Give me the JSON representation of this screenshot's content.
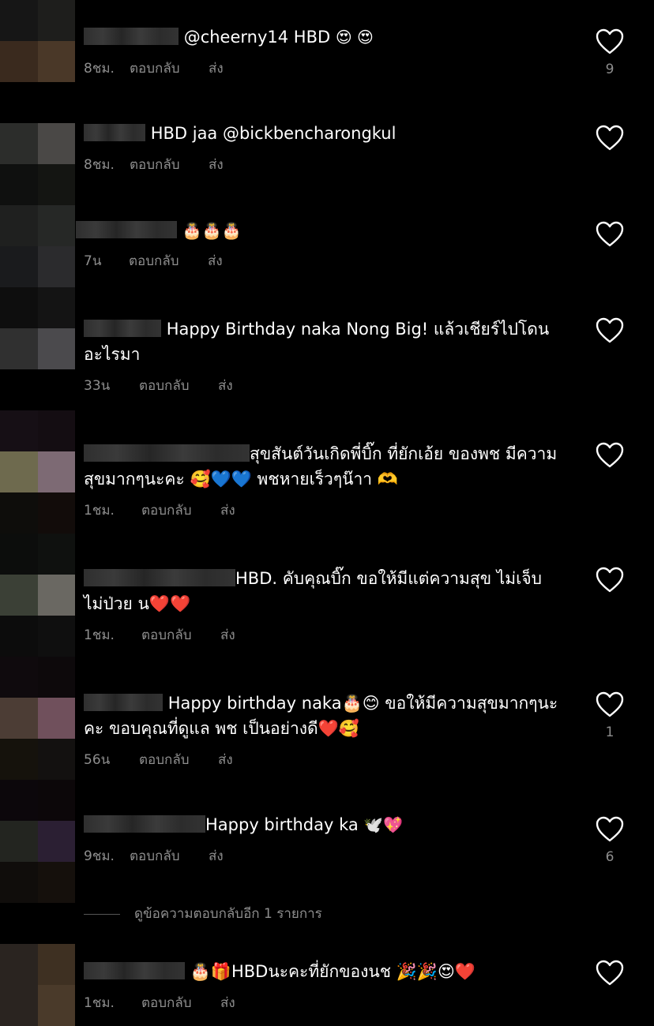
{
  "comments": [
    {
      "text": "@cheerny14 HBD",
      "emoji": "😍 😍",
      "time": "8ชม.",
      "reply": "ตอบกลับ",
      "send": "ส่ง",
      "likes": "9"
    },
    {
      "text": "HBD jaa @bickbencharongkul",
      "emoji": "",
      "time": "8ชม.",
      "reply": "ตอบกลับ",
      "send": "ส่ง",
      "likes": ""
    },
    {
      "text": "",
      "emoji": "🎂🎂🎂",
      "time": "7น",
      "reply": "ตอบกลับ",
      "send": "ส่ง",
      "likes": ""
    },
    {
      "text": "Happy Birthday naka Nong Big! แล้วเชียร์ไปโดนอะไรมา",
      "emoji": "",
      "time": "33น",
      "reply": "ตอบกลับ",
      "send": "ส่ง",
      "likes": ""
    },
    {
      "text": "สุขสันต์วันเกิดพี่บิ๊ก ที่ยักเอ้ย ของพช มีความสุขมากๆนะคะ 🥰💙💙 พชหายเร็วๆน๊าา 🫶",
      "emoji": "",
      "time": "1ชม.",
      "reply": "ตอบกลับ",
      "send": "ส่ง",
      "likes": ""
    },
    {
      "text": "HBD. คับคุณบิ๊ก ขอให้มีแต่ความสุข  ไม่เจ็บ ไม่ป่วย  น❤️❤️",
      "emoji": "",
      "time": "1ชม.",
      "reply": "ตอบกลับ",
      "send": "ส่ง",
      "likes": ""
    },
    {
      "text": "Happy birthday naka🎂😊 ขอให้มีความสุขมากๆนะคะ ขอบคุณที่ดูแล พช เป็นอย่างดี❤️🥰",
      "emoji": "",
      "time": "56น",
      "reply": "ตอบกลับ",
      "send": "ส่ง",
      "likes": "1"
    },
    {
      "text": "Happy birthday ka",
      "emoji": "🕊️💖",
      "time": "9ชม.",
      "reply": "ตอบกลับ",
      "send": "ส่ง",
      "likes": "6"
    },
    {
      "text": "🎂🎁HBDนะคะที่ยักของนช 🎉🎉😍❤️",
      "emoji": "",
      "time": "1ชม.",
      "reply": "ตอบกลับ",
      "send": "ส่ง",
      "likes": ""
    }
  ],
  "view_more": "ดูข้อความตอบกลับอีก 1 รายการ",
  "colors": {
    "background": "#000000",
    "meta": "#8e8e8e"
  }
}
